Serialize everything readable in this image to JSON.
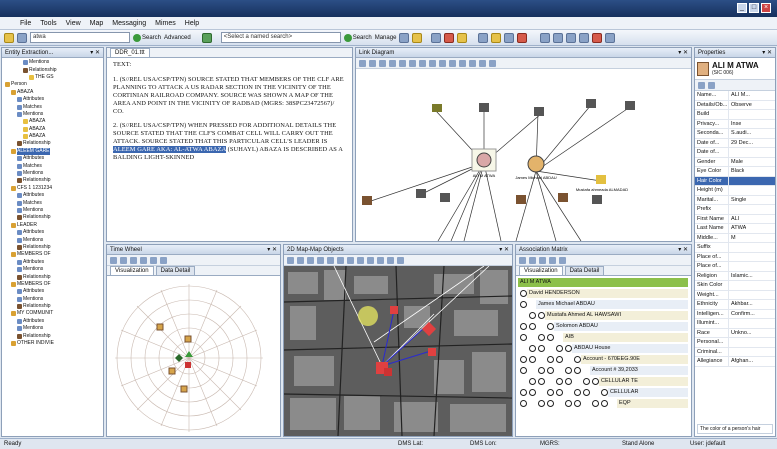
{
  "menu": [
    "File",
    "Tools",
    "View",
    "Map",
    "Messaging",
    "Mimes",
    "Help"
  ],
  "toolbar": {
    "search_value": "atwa",
    "search_btn": "Search",
    "advanced_btn": "Advanced",
    "named_search_placeholder": "<Select a named search>",
    "search2_btn": "Search",
    "manage_btn": "Manage"
  },
  "explorer": {
    "title": "Entity Extraction...",
    "rows": [
      {
        "d": 3,
        "i": "a",
        "t": "Mentions"
      },
      {
        "d": 3,
        "i": "r",
        "t": "Relationship"
      },
      {
        "d": 4,
        "i": "m",
        "t": "THE GS"
      },
      {
        "d": 0,
        "i": "p",
        "t": "Person"
      },
      {
        "d": 1,
        "i": "p",
        "t": "ABAZA"
      },
      {
        "d": 2,
        "i": "a",
        "t": "Attributes"
      },
      {
        "d": 2,
        "i": "a",
        "t": "Matches"
      },
      {
        "d": 2,
        "i": "a",
        "t": "Mentions"
      },
      {
        "d": 3,
        "i": "m",
        "t": "ABAZA"
      },
      {
        "d": 3,
        "i": "m",
        "t": "ABAZA"
      },
      {
        "d": 3,
        "i": "m",
        "t": "ABAZA"
      },
      {
        "d": 2,
        "i": "r",
        "t": "Relationship"
      },
      {
        "d": 1,
        "i": "p",
        "t": "ALEEM GARE",
        "sel": true
      },
      {
        "d": 2,
        "i": "a",
        "t": "Attributes"
      },
      {
        "d": 2,
        "i": "a",
        "t": "Matches"
      },
      {
        "d": 2,
        "i": "a",
        "t": "Mentions"
      },
      {
        "d": 2,
        "i": "r",
        "t": "Relationship"
      },
      {
        "d": 1,
        "i": "p",
        "t": "CFS 1 1231234"
      },
      {
        "d": 2,
        "i": "a",
        "t": "Attributes"
      },
      {
        "d": 2,
        "i": "a",
        "t": "Matches"
      },
      {
        "d": 2,
        "i": "a",
        "t": "Mentions"
      },
      {
        "d": 2,
        "i": "r",
        "t": "Relationship"
      },
      {
        "d": 1,
        "i": "p",
        "t": "LEADER"
      },
      {
        "d": 2,
        "i": "a",
        "t": "Attributes"
      },
      {
        "d": 2,
        "i": "a",
        "t": "Mentions"
      },
      {
        "d": 2,
        "i": "r",
        "t": "Relationship"
      },
      {
        "d": 1,
        "i": "p",
        "t": "MEMBERS OF"
      },
      {
        "d": 2,
        "i": "a",
        "t": "Attributes"
      },
      {
        "d": 2,
        "i": "a",
        "t": "Mentions"
      },
      {
        "d": 2,
        "i": "r",
        "t": "Relationship"
      },
      {
        "d": 1,
        "i": "p",
        "t": "MEMBERS OF"
      },
      {
        "d": 2,
        "i": "a",
        "t": "Attributes"
      },
      {
        "d": 2,
        "i": "a",
        "t": "Mentions"
      },
      {
        "d": 2,
        "i": "r",
        "t": "Relationship"
      },
      {
        "d": 1,
        "i": "p",
        "t": "MY COMMUNIT"
      },
      {
        "d": 2,
        "i": "a",
        "t": "Attributes"
      },
      {
        "d": 2,
        "i": "a",
        "t": "Mentions"
      },
      {
        "d": 2,
        "i": "r",
        "t": "Relationship"
      },
      {
        "d": 1,
        "i": "p",
        "t": "OTHER INDIVIE"
      }
    ]
  },
  "document": {
    "tab": "DDR_01.ttt",
    "para1": "TEXT:",
    "para2": "1.  (S//REL USA/CSP/TPN) SOURCE STATED THAT MEMBERS OF THE CLF ARE PLANNING TO ATTACK A US RADAR SECTION IN THE VICINITY OF THE CORTINIAN RAILROAD COMPANY.  SOURCE WAS SHOWN A MAP OF THE AREA AND POINT IN THE VICINITY OF RADBAD (MGRS: 38SPC23472567)/ CO.",
    "para3a": "2.  (S//REL USA/CSP/TPN) WHEN PRESSED FOR ADDITIONAL DETAILS THE SOURCE STATED THAT THE CLF'S COMBAT CELL WILL CARRY OUT THE ATTACK. SOURCE STATED THAT THIS PARTICULAR CELL'S LEADER IS",
    "para3hl": "ALEEM GARE AKA: AL-ATWA ABAZA",
    "para3b": "(SUHAYL) ABAZA IS DESCRIBED AS A BALDING LIGHT-SKINNED"
  },
  "link": {
    "title": "Link Diagram",
    "labels": {
      "ali": "ALI M ATWA",
      "james": "James Michael ABDAU",
      "mustafa": "Mustafa ahmeada ALMADAD"
    }
  },
  "timewheel": {
    "title": "Time Wheel",
    "tab1": "Visualization",
    "tab2": "Data Detail"
  },
  "map": {
    "title": "2D Map-Map Objects"
  },
  "assoc": {
    "title": "Association Matrix",
    "tab1": "Visualization",
    "tab2": "Data Detail",
    "rows": [
      "ALI M ATWA",
      "David HENDERSON",
      "James Michael ABDAU",
      "Mustafa Ahmed AL HAWSAWI",
      "Solomon ABDAU",
      "AIB",
      "ABDAU House",
      "Account - 670EEG.90E",
      "Account # 39,2033",
      "CELLULAR TE",
      "CELLULAR",
      "EQP"
    ]
  },
  "properties": {
    "title": "Properties",
    "entity": "ALI M ATWA",
    "entity_sub": "(SIC 006)",
    "rows": [
      [
        "Name...",
        "ALI M..."
      ],
      [
        "Details/Ob...",
        "Observe"
      ],
      [
        "Build",
        ""
      ],
      [
        "Privacy...",
        "Inse"
      ],
      [
        "Seconda...",
        "S.audi..."
      ],
      [
        "Date of...",
        "29 Dec..."
      ],
      [
        "Date of...",
        ""
      ],
      [
        "Gender",
        "Male"
      ],
      [
        "Eye Color",
        "Black"
      ],
      [
        "Hair Color",
        "",
        "sel"
      ],
      [
        "Height (m)",
        ""
      ],
      [
        "Marital...",
        "Single"
      ],
      [
        "Prefix",
        ""
      ],
      [
        "First Name",
        "ALI"
      ],
      [
        "Last Name",
        "ATWA"
      ],
      [
        "Middle...",
        "M"
      ],
      [
        "Suffix",
        ""
      ],
      [
        "Place of...",
        ""
      ],
      [
        "Place of...",
        ""
      ],
      [
        "Religion",
        "Islamic..."
      ],
      [
        "Skin Color",
        ""
      ],
      [
        "Weight...",
        ""
      ],
      [
        "Ethnicity",
        "Akhbar..."
      ],
      [
        "Intelligen...",
        "Confirm..."
      ],
      [
        "Illumint...",
        ""
      ],
      [
        "Race",
        "Unkno..."
      ],
      [
        "Personal...",
        ""
      ],
      [
        "Criminal...",
        ""
      ],
      [
        "Allegiance",
        "Afghan..."
      ]
    ],
    "desc": "The color of a person's hair"
  },
  "status": {
    "ready": "Ready",
    "lat": "DMS Lat:",
    "lon": "DMS Lon:",
    "mgrs": "MGRS:",
    "mode": "Stand Alone",
    "user": "User: jdefault"
  }
}
